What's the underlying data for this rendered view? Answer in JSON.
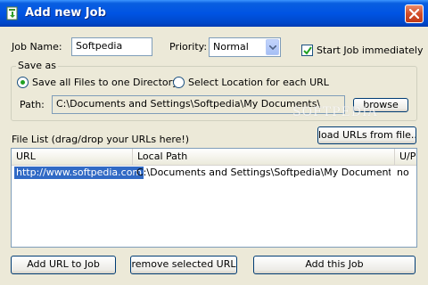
{
  "window": {
    "title": "Add new Job",
    "watermark": "SOFTPEDIA"
  },
  "job": {
    "name_label": "Job Name:",
    "name_value": "Softpedia",
    "priority_label": "Priority:",
    "priority_value": "Normal",
    "start_immediately_label": "Start Job immediately",
    "start_immediately_checked": true
  },
  "save_as": {
    "legend": "Save as",
    "option_one_dir_label": "Save all Files to one Directory",
    "option_each_url_label": "Select Location for each URL",
    "selected_option": "one_dir",
    "path_label": "Path:",
    "path_value": "C:\\Documents and Settings\\Softpedia\\My Documents\\",
    "browse_label": "browse"
  },
  "file_list": {
    "label": "File List (drag/drop your URLs here!)",
    "load_urls_label": "load URLs from file...",
    "columns": [
      "URL",
      "Local Path",
      "U/P"
    ],
    "rows": [
      {
        "url": "http://www.softpedia.com",
        "local_path": "C:\\Documents and Settings\\Softpedia\\My Documents\\w...",
        "up": "no"
      }
    ]
  },
  "buttons": {
    "add_url": "Add URL to Job",
    "remove_selected": "remove selected URL",
    "add_job": "Add this Job"
  },
  "icons": {
    "app": "download-icon",
    "close": "close-icon",
    "dropdown": "chevron-down-icon",
    "check": "check-icon"
  },
  "colors": {
    "titlebar": "#0054e3",
    "dialog_bg": "#ece9d8",
    "selection": "#316ac5",
    "close_button": "#d24e2a"
  }
}
